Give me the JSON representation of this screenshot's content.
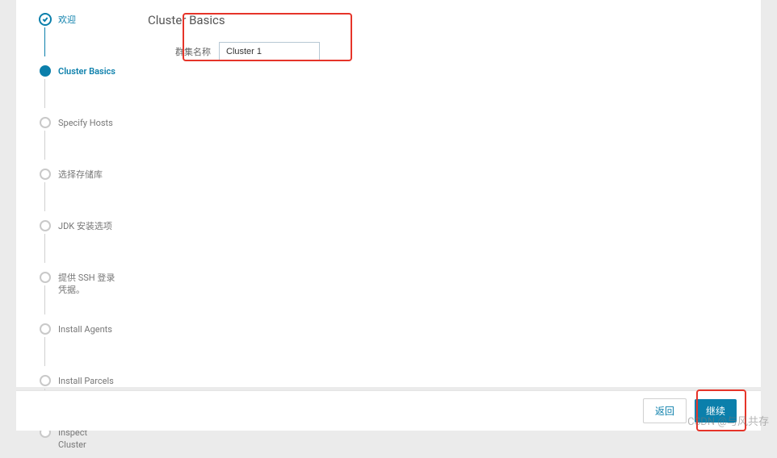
{
  "sidebar": {
    "steps": [
      {
        "label": "欢迎",
        "state": "completed"
      },
      {
        "label": "Cluster Basics",
        "state": "active"
      },
      {
        "label": "Specify Hosts",
        "state": "pending"
      },
      {
        "label": "选择存储库",
        "state": "pending"
      },
      {
        "label": "JDK 安装选项",
        "state": "pending"
      },
      {
        "label": "提供 SSH 登录凭据。",
        "state": "pending"
      },
      {
        "label": "Install Agents",
        "state": "pending"
      },
      {
        "label": "Install Parcels",
        "state": "pending"
      },
      {
        "label": "Inspect Cluster",
        "state": "pending"
      }
    ]
  },
  "main": {
    "title": "Cluster Basics",
    "form": {
      "cluster_name_label": "群集名称",
      "cluster_name_value": "Cluster 1"
    }
  },
  "footer": {
    "back_label": "返回",
    "continue_label": "继续"
  },
  "watermark": "CSDN @与风共存"
}
